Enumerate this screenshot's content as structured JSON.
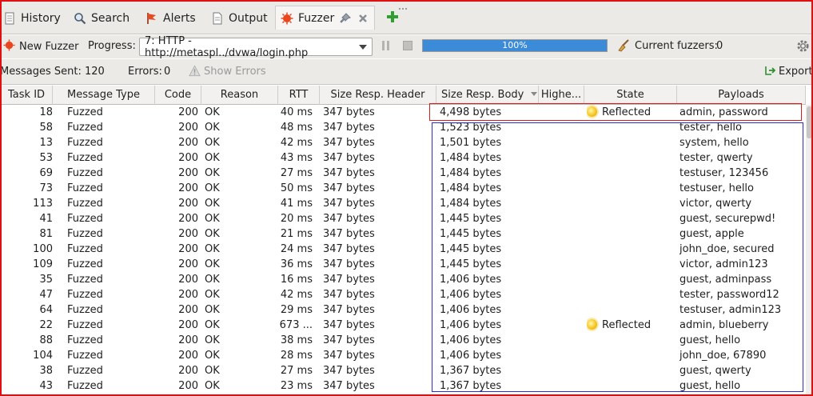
{
  "tabs": [
    {
      "label": "History",
      "icon": "history-icon"
    },
    {
      "label": "Search",
      "icon": "search-icon"
    },
    {
      "label": "Alerts",
      "icon": "alerts-flag-icon"
    },
    {
      "label": "Output",
      "icon": "output-icon"
    },
    {
      "label": "Fuzzer",
      "icon": "fuzzer-icon",
      "active": true
    }
  ],
  "toolbar": {
    "new_fuzzer_label": "New Fuzzer",
    "progress_label": "Progress:",
    "progress_select_value": "7: HTTP - http://metaspl../dvwa/login.php",
    "progress_percent_text": "100%",
    "progress_fraction": 1.0,
    "current_fuzzers_label": "Current fuzzers:",
    "current_fuzzers_value": "0"
  },
  "stats": {
    "messages_sent_label": "Messages Sent:",
    "messages_sent_value": "120",
    "errors_label": "Errors:",
    "errors_value": "0",
    "show_errors_label": "Show Errors",
    "export_label": "Export"
  },
  "table": {
    "columns": [
      "Task ID",
      "Message Type",
      "Code",
      "Reason",
      "RTT",
      "Size Resp. Header",
      "Size Resp. Body",
      "Highe...",
      "State",
      "Payloads"
    ],
    "rows": [
      {
        "task_id": "18",
        "type": "Fuzzed",
        "code": "200",
        "reason": "OK",
        "rtt": "40 ms",
        "header": "347 bytes",
        "body": "4,498 bytes",
        "highest": "",
        "state": "Reflected",
        "payloads": "admin, password"
      },
      {
        "task_id": "58",
        "type": "Fuzzed",
        "code": "200",
        "reason": "OK",
        "rtt": "48 ms",
        "header": "347 bytes",
        "body": "1,523 bytes",
        "highest": "",
        "state": "",
        "payloads": "tester, hello"
      },
      {
        "task_id": "13",
        "type": "Fuzzed",
        "code": "200",
        "reason": "OK",
        "rtt": "42 ms",
        "header": "347 bytes",
        "body": "1,501 bytes",
        "highest": "",
        "state": "",
        "payloads": "system, hello"
      },
      {
        "task_id": "53",
        "type": "Fuzzed",
        "code": "200",
        "reason": "OK",
        "rtt": "43 ms",
        "header": "347 bytes",
        "body": "1,484 bytes",
        "highest": "",
        "state": "",
        "payloads": "tester, qwerty"
      },
      {
        "task_id": "69",
        "type": "Fuzzed",
        "code": "200",
        "reason": "OK",
        "rtt": "27 ms",
        "header": "347 bytes",
        "body": "1,484 bytes",
        "highest": "",
        "state": "",
        "payloads": "testuser, 123456"
      },
      {
        "task_id": "73",
        "type": "Fuzzed",
        "code": "200",
        "reason": "OK",
        "rtt": "50 ms",
        "header": "347 bytes",
        "body": "1,484 bytes",
        "highest": "",
        "state": "",
        "payloads": "testuser, hello"
      },
      {
        "task_id": "113",
        "type": "Fuzzed",
        "code": "200",
        "reason": "OK",
        "rtt": "41 ms",
        "header": "347 bytes",
        "body": "1,484 bytes",
        "highest": "",
        "state": "",
        "payloads": "victor, qwerty"
      },
      {
        "task_id": "41",
        "type": "Fuzzed",
        "code": "200",
        "reason": "OK",
        "rtt": "20 ms",
        "header": "347 bytes",
        "body": "1,445 bytes",
        "highest": "",
        "state": "",
        "payloads": "guest, securepwd!"
      },
      {
        "task_id": "81",
        "type": "Fuzzed",
        "code": "200",
        "reason": "OK",
        "rtt": "21 ms",
        "header": "347 bytes",
        "body": "1,445 bytes",
        "highest": "",
        "state": "",
        "payloads": "guest, apple"
      },
      {
        "task_id": "100",
        "type": "Fuzzed",
        "code": "200",
        "reason": "OK",
        "rtt": "24 ms",
        "header": "347 bytes",
        "body": "1,445 bytes",
        "highest": "",
        "state": "",
        "payloads": "john_doe, secured"
      },
      {
        "task_id": "109",
        "type": "Fuzzed",
        "code": "200",
        "reason": "OK",
        "rtt": "36 ms",
        "header": "347 bytes",
        "body": "1,445 bytes",
        "highest": "",
        "state": "",
        "payloads": "victor, admin123"
      },
      {
        "task_id": "35",
        "type": "Fuzzed",
        "code": "200",
        "reason": "OK",
        "rtt": "16 ms",
        "header": "347 bytes",
        "body": "1,406 bytes",
        "highest": "",
        "state": "",
        "payloads": "guest, adminpass"
      },
      {
        "task_id": "47",
        "type": "Fuzzed",
        "code": "200",
        "reason": "OK",
        "rtt": "42 ms",
        "header": "347 bytes",
        "body": "1,406 bytes",
        "highest": "",
        "state": "",
        "payloads": "tester, password12"
      },
      {
        "task_id": "64",
        "type": "Fuzzed",
        "code": "200",
        "reason": "OK",
        "rtt": "29 ms",
        "header": "347 bytes",
        "body": "1,406 bytes",
        "highest": "",
        "state": "",
        "payloads": "testuser, admin123"
      },
      {
        "task_id": "22",
        "type": "Fuzzed",
        "code": "200",
        "reason": "OK",
        "rtt": "673 ...",
        "header": "347 bytes",
        "body": "1,406 bytes",
        "highest": "",
        "state": "Reflected",
        "payloads": "admin, blueberry"
      },
      {
        "task_id": "88",
        "type": "Fuzzed",
        "code": "200",
        "reason": "OK",
        "rtt": "38 ms",
        "header": "347 bytes",
        "body": "1,406 bytes",
        "highest": "",
        "state": "",
        "payloads": "guest, hello"
      },
      {
        "task_id": "104",
        "type": "Fuzzed",
        "code": "200",
        "reason": "OK",
        "rtt": "28 ms",
        "header": "347 bytes",
        "body": "1,406 bytes",
        "highest": "",
        "state": "",
        "payloads": "john_doe, 67890"
      },
      {
        "task_id": "38",
        "type": "Fuzzed",
        "code": "200",
        "reason": "OK",
        "rtt": "27 ms",
        "header": "347 bytes",
        "body": "1,367 bytes",
        "highest": "",
        "state": "",
        "payloads": "guest, qwerty"
      },
      {
        "task_id": "43",
        "type": "Fuzzed",
        "code": "200",
        "reason": "OK",
        "rtt": "23 ms",
        "header": "347 bytes",
        "body": "1,367 bytes",
        "highest": "",
        "state": "",
        "payloads": "guest, hello"
      }
    ]
  },
  "colors": {
    "highlight_red": "#d91b1b",
    "highlight_blue": "#2a2ad0",
    "progress_fill": "#3b8bd8"
  }
}
